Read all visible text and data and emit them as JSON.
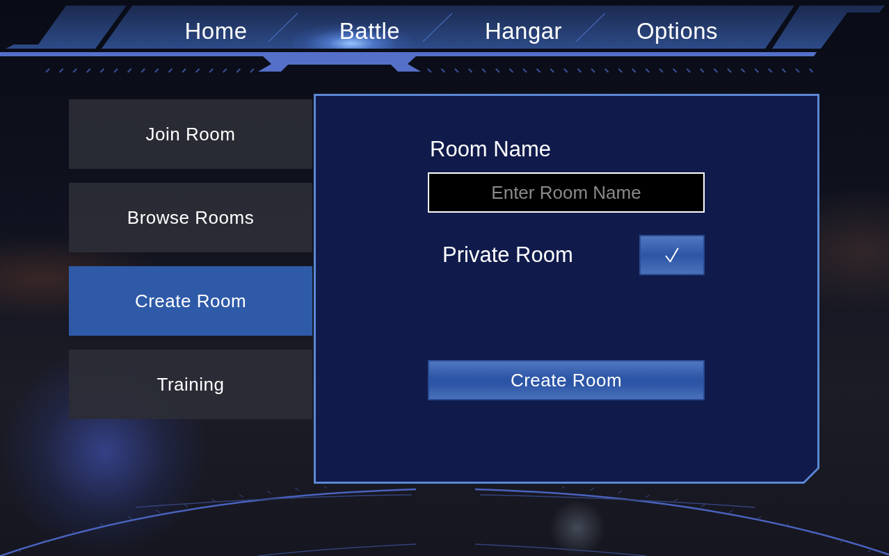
{
  "nav": {
    "tabs": [
      {
        "label": "Home",
        "selected": false
      },
      {
        "label": "Battle",
        "selected": true
      },
      {
        "label": "Hangar",
        "selected": false
      },
      {
        "label": "Options",
        "selected": false
      }
    ]
  },
  "sidebar": {
    "items": [
      {
        "label": "Join Room",
        "selected": false
      },
      {
        "label": "Browse Rooms",
        "selected": false
      },
      {
        "label": "Create Room",
        "selected": true
      },
      {
        "label": "Training",
        "selected": false
      }
    ]
  },
  "create_room_panel": {
    "room_name": {
      "label": "Room Name",
      "placeholder": "Enter Room Name"
    },
    "private_room": {
      "label": "Private Room",
      "checked": true
    },
    "submit_button": "Create Room"
  }
}
